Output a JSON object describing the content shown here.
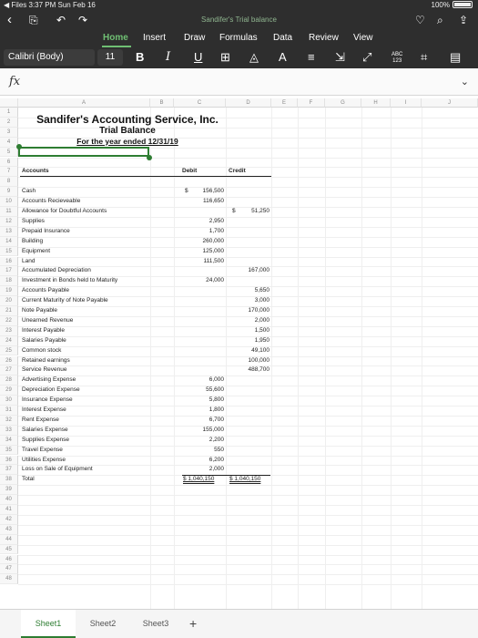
{
  "statusbar": {
    "left": "◀ Files  3:37 PM  Sun Feb 16",
    "right": "100%"
  },
  "document_title": "Sandifer's Trial balance",
  "ribbon_tabs": [
    {
      "label": "Home",
      "active": true
    },
    {
      "label": "Insert"
    },
    {
      "label": "Draw"
    },
    {
      "label": "Formulas"
    },
    {
      "label": "Data"
    },
    {
      "label": "Review"
    },
    {
      "label": "View"
    }
  ],
  "format": {
    "font": "Calibri (Body)",
    "size": "11",
    "bold": "B",
    "italic": "I",
    "underline": "U",
    "abc": "ABC\n123"
  },
  "formula_bar": {
    "fx": "fx",
    "value": ""
  },
  "columns": [
    "A",
    "B",
    "C",
    "D",
    "E",
    "F",
    "G",
    "H",
    "I",
    "J"
  ],
  "rows": [
    "1",
    "2",
    "3",
    "4",
    "5",
    "6",
    "7",
    "8",
    "9",
    "10",
    "11",
    "12",
    "13",
    "14",
    "15",
    "16",
    "17",
    "18",
    "19",
    "20",
    "21",
    "22",
    "23",
    "24",
    "25",
    "26",
    "27",
    "28",
    "29",
    "30",
    "31",
    "32",
    "33",
    "34",
    "35",
    "36",
    "37",
    "38",
    "39",
    "40",
    "41",
    "42",
    "43",
    "44",
    "45",
    "46",
    "47",
    "48"
  ],
  "sheet": {
    "title": "Sandifer's Accounting Service, Inc.",
    "subtitle": "Trial Balance",
    "period": "For the year ended 12/31/19",
    "headers": {
      "accounts": "Accounts",
      "debit": "Debit",
      "credit": "Credit"
    },
    "currency": "$",
    "entries": [
      {
        "row": 8,
        "account": "Cash",
        "debit": "156,500",
        "credit": "",
        "debit_dollar": true
      },
      {
        "row": 9,
        "account": "Accounts Recieveable",
        "debit": "116,650",
        "credit": ""
      },
      {
        "row": 10,
        "account": "Allowance for Doubtful Accounts",
        "debit": "",
        "credit": "51,250",
        "credit_dollar": true
      },
      {
        "row": 11,
        "account": "Supplies",
        "debit": "2,950",
        "credit": ""
      },
      {
        "row": 12,
        "account": "Prepaid Insurance",
        "debit": "1,700",
        "credit": ""
      },
      {
        "row": 13,
        "account": "Building",
        "debit": "260,000",
        "credit": ""
      },
      {
        "row": 14,
        "account": "Equipment",
        "debit": "125,000",
        "credit": ""
      },
      {
        "row": 15,
        "account": "Land",
        "debit": "111,500",
        "credit": ""
      },
      {
        "row": 16,
        "account": "Accumulated Depreciation",
        "debit": "",
        "credit": "167,000"
      },
      {
        "row": 17,
        "account": "Investment in Bonds held to Maturity",
        "debit": "24,000",
        "credit": ""
      },
      {
        "row": 18,
        "account": "Accounts Payable",
        "debit": "",
        "credit": "5,650"
      },
      {
        "row": 19,
        "account": "Current Maturity of Note Payable",
        "debit": "",
        "credit": "3,000"
      },
      {
        "row": 20,
        "account": "Note Payable",
        "debit": "",
        "credit": "170,000"
      },
      {
        "row": 21,
        "account": "Unearned Revenue",
        "debit": "",
        "credit": "2,000"
      },
      {
        "row": 22,
        "account": "Interest Payable",
        "debit": "",
        "credit": "1,500"
      },
      {
        "row": 23,
        "account": "Salaries Payable",
        "debit": "",
        "credit": "1,950"
      },
      {
        "row": 24,
        "account": "Common stock",
        "debit": "",
        "credit": "49,100"
      },
      {
        "row": 25,
        "account": "Retained earnings",
        "debit": "",
        "credit": "100,000"
      },
      {
        "row": 26,
        "account": "Service Revenue",
        "debit": "",
        "credit": "488,700"
      },
      {
        "row": 27,
        "account": "Advertising Expense",
        "debit": "6,000",
        "credit": ""
      },
      {
        "row": 28,
        "account": "Depreciation Expense",
        "debit": "55,600",
        "credit": ""
      },
      {
        "row": 29,
        "account": "Insurance Expense",
        "debit": "5,800",
        "credit": ""
      },
      {
        "row": 30,
        "account": "Interest Expense",
        "debit": "1,800",
        "credit": ""
      },
      {
        "row": 31,
        "account": "Rent Expense",
        "debit": "6,700",
        "credit": ""
      },
      {
        "row": 32,
        "account": "Salaries Expense",
        "debit": "155,000",
        "credit": ""
      },
      {
        "row": 33,
        "account": "Supplies Expense",
        "debit": "2,200",
        "credit": ""
      },
      {
        "row": 34,
        "account": "Travel Expense",
        "debit": "550",
        "credit": ""
      },
      {
        "row": 35,
        "account": "Utilities Expense",
        "debit": "6,200",
        "credit": ""
      },
      {
        "row": 36,
        "account": "Loss on Sale of Equipment",
        "debit": "2,000",
        "credit": ""
      }
    ],
    "total": {
      "row": 37,
      "label": "Total",
      "debit": "$  1,040,150",
      "credit": "$  1,040,150"
    }
  },
  "sheet_tabs": [
    {
      "label": "Sheet1",
      "active": true
    },
    {
      "label": "Sheet2"
    },
    {
      "label": "Sheet3"
    }
  ],
  "add_sheet": "+"
}
